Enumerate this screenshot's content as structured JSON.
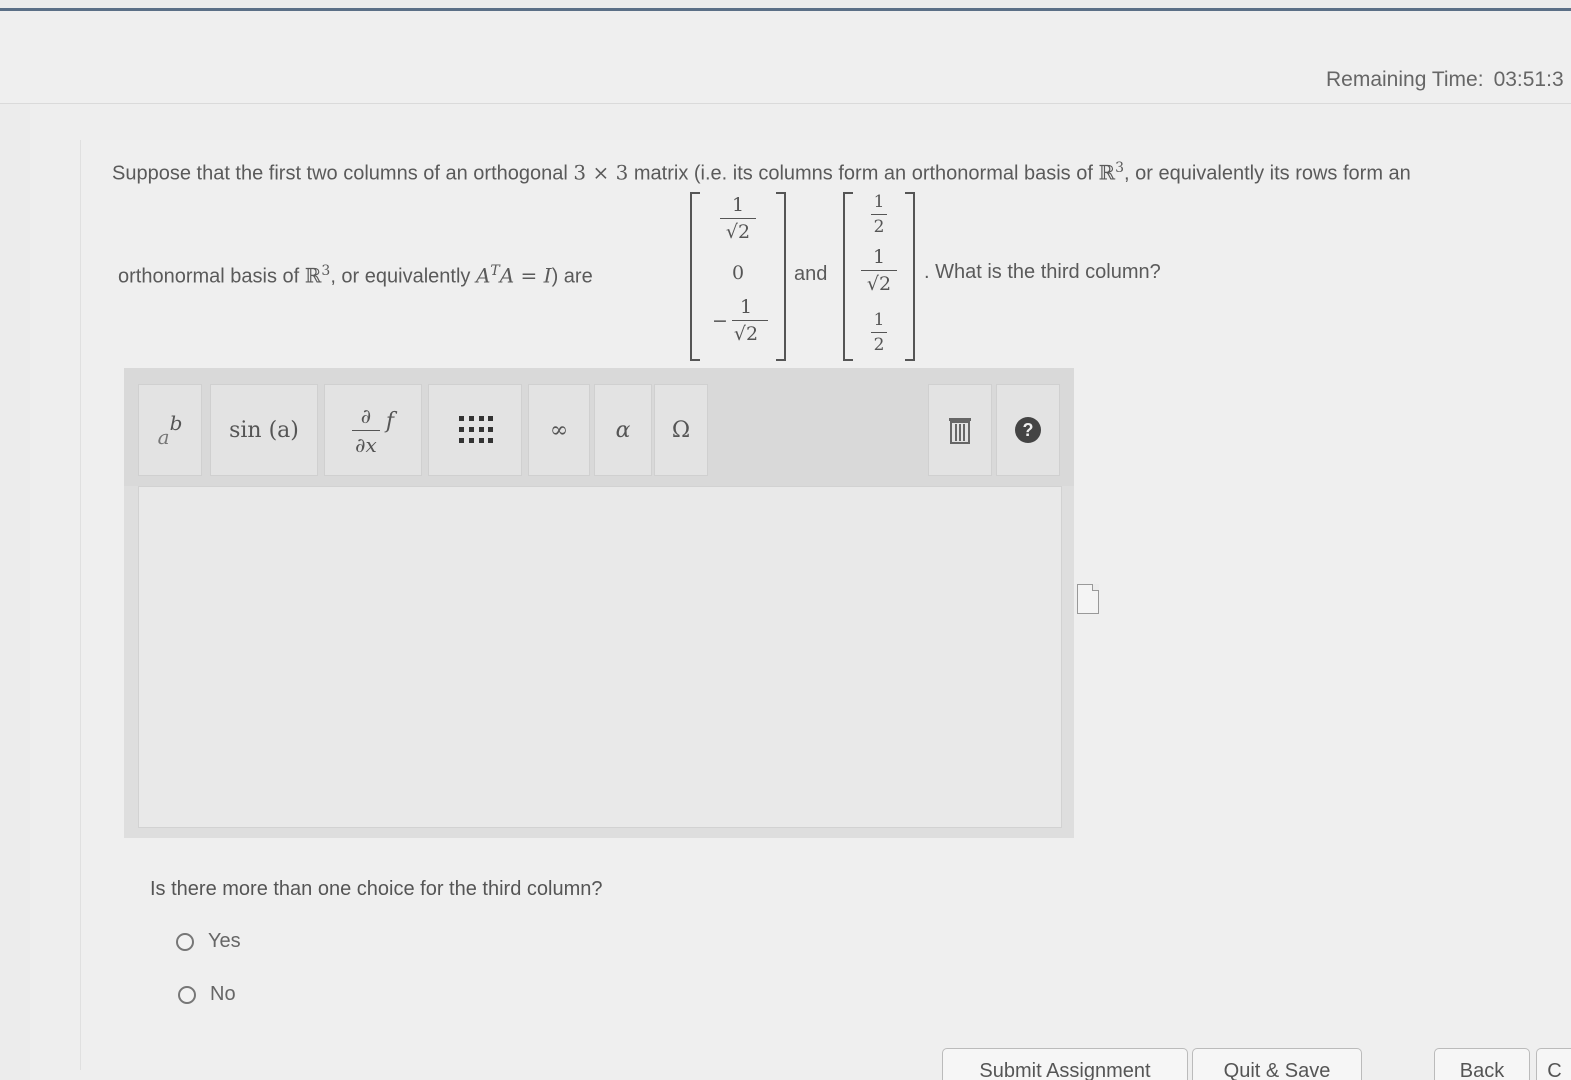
{
  "header": {
    "timer_label": "Remaining Time:",
    "timer_value": "03:51:3"
  },
  "question": {
    "line1_pre": "Suppose that the first two columns of an orthogonal ",
    "line1_dims": "3 × 3",
    "line1_mid": " matrix  (i.e. its columns form an orthonormal basis of ",
    "line1_R": "ℝ",
    "line1_R_exp": "3",
    "line1_post": ", or equivalently its rows form an",
    "line2_pre": "orthonormal basis of ",
    "line2_R": "ℝ",
    "line2_R_exp": "3",
    "line2_mid": ", or equivalently ",
    "line2_A": "A",
    "line2_T": "T",
    "line2_eq": "A = I",
    "line2_post": ") are",
    "and_word": "and",
    "tail": ". What is the third column?",
    "col1": {
      "e1_num": "1",
      "e1_den": "√2",
      "e2": "0",
      "e3_sign": "−",
      "e3_num": "1",
      "e3_den": "√2"
    },
    "col2": {
      "e1_num": "1",
      "e1_den": "2",
      "e2_num": "1",
      "e2_den": "√2",
      "e3_num": "1",
      "e3_den": "2"
    }
  },
  "toolbar": {
    "power_base": "a",
    "power_exp": "b",
    "sin": "sin (a)",
    "deriv_num": "∂",
    "deriv_den": "∂x",
    "deriv_f": "f",
    "infinity": "∞",
    "alpha": "α",
    "omega": "Ω",
    "help": "?"
  },
  "question2": {
    "text": "Is there more than one choice for the third column?",
    "options": [
      "Yes",
      "No"
    ]
  },
  "footer": {
    "submit": "Submit Assignment",
    "quit": "Quit & Save",
    "back": "Back",
    "next": "C"
  }
}
